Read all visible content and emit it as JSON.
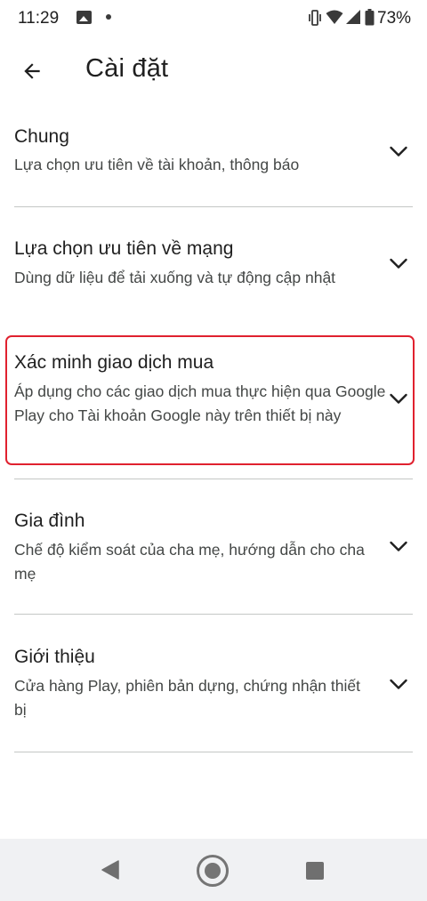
{
  "status_bar": {
    "time": "11:29",
    "battery": "73%",
    "icons": [
      "image-icon",
      "dot-icon",
      "vibrate-icon",
      "wifi-icon",
      "signal-icon",
      "battery-icon"
    ]
  },
  "app_bar": {
    "back_icon": "arrow-back-icon",
    "title": "Cài đặt"
  },
  "settings": [
    {
      "title": "Chung",
      "subtitle": "Lựa chọn ưu tiên về tài khoản, thông báo",
      "icon": "chevron-down-icon"
    },
    {
      "title": "Lựa chọn ưu tiên về mạng",
      "subtitle": "Dùng dữ liệu để tải xuống và tự động cập nhật",
      "icon": "chevron-down-icon"
    },
    {
      "title": "Xác minh giao dịch mua",
      "subtitle": "Áp dụng cho các giao dịch mua thực hiện qua Google Play cho Tài khoản Google này trên thiết bị này",
      "icon": "chevron-down-icon",
      "highlighted": true
    },
    {
      "title": "Gia đình",
      "subtitle": "Chế độ kiểm soát của cha mẹ, hướng dẫn cho cha mẹ",
      "icon": "chevron-down-icon"
    },
    {
      "title": "Giới thiệu",
      "subtitle": "Cửa hàng Play, phiên bản dựng, chứng nhận thiết bị",
      "icon": "chevron-down-icon"
    }
  ],
  "colors": {
    "highlight": "#e0212f",
    "text_primary": "#1f1f1f",
    "text_secondary": "#444746",
    "divider": "#c4c7c5",
    "nav_bar": "#f0f1f3"
  },
  "nav_bar": {
    "icons": [
      "nav-back-icon",
      "nav-home-icon",
      "nav-recents-icon"
    ]
  }
}
